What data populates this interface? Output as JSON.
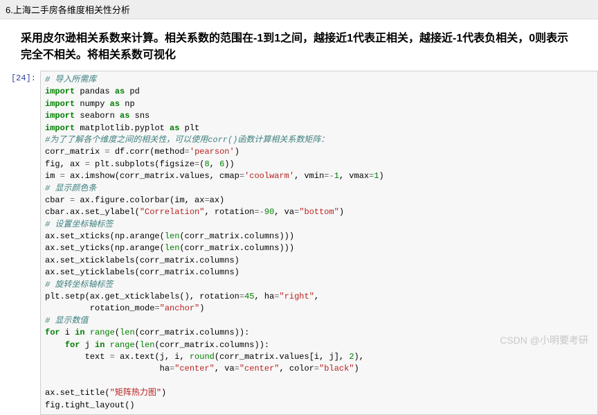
{
  "section": {
    "title": "6.上海二手房各维度相关性分析"
  },
  "markdown": {
    "text": "采用皮尔逊相关系数来计算。相关系数的范围在-1到1之间，越接近1代表正相关，越接近-1代表负相关，0则表示完全不相关。将相关系数可视化"
  },
  "prompt": "[24]:",
  "code": {
    "c1": "# 导入所需库",
    "l2a": "import",
    "l2b": " pandas ",
    "l2c": "as",
    "l2d": " pd",
    "l3a": "import",
    "l3b": " numpy ",
    "l3c": "as",
    "l3d": " np",
    "l4a": "import",
    "l4b": " seaborn ",
    "l4c": "as",
    "l4d": " sns",
    "l5a": "import",
    "l5b": " matplotlib.pyplot ",
    "l5c": "as",
    "l5d": " plt",
    "c2": "#为了了解各个维度之间的相关性，可以使用corr()函数计算相关系数矩阵：",
    "l6t": "corr_matrix ",
    "l6s1": "'",
    "l6s2": "pearson",
    "l6s3": "'",
    "l7n1": "8",
    "l7n2": "6",
    "l8s1": "'",
    "l8s2": "coolwarm",
    "l8s3": "'",
    "l8n1": "-",
    "l8n2": "1",
    "l8n3": "1",
    "c3": "# 显示颜色条",
    "l10s1": "\"Correlation\"",
    "l10n1": "-",
    "l10n2": "90",
    "l10s2": "\"bottom\"",
    "c4": "# 设置坐标轴标签",
    "c5": "# 旋转坐标轴标签",
    "l15n": "45",
    "l15s1": "\"right\"",
    "l16s1": "\"anchor\"",
    "c6": "# 显示数值",
    "l17a": "for",
    "l17b": "in",
    "l17c": "range",
    "l17d": "len",
    "l18a": "for",
    "l18b": "in",
    "l18c": "range",
    "l18d": "len",
    "l19n": "2",
    "l19r": "round",
    "l20s1": "\"center\"",
    "l20s2": "\"center\"",
    "l20s3": "\"black\"",
    "l21s": "\"矩阵热力图\""
  },
  "watermark": "CSDN @小明要考研"
}
